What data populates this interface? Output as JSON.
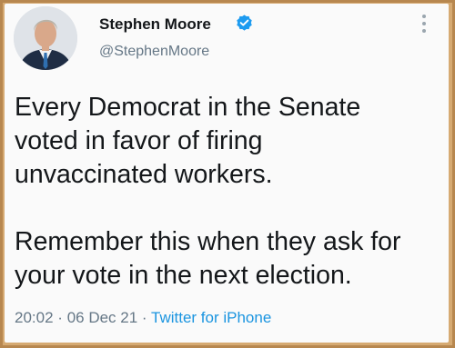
{
  "tweet": {
    "display_name": "Stephen Moore",
    "handle": "@StephenMoore",
    "verified_icon": "verified-badge-icon",
    "text": "Every Democrat in the Senate\nvoted in favor of firing\nunvaccinated workers.\n\nRemember this when they ask for\nyour vote in the next election.",
    "time": "20:02",
    "date": "06 Dec 21",
    "separator": "·",
    "source": "Twitter for iPhone"
  },
  "colors": {
    "frame": "#c8995f",
    "card_background": "#fafafa",
    "text_primary": "#14171a",
    "text_secondary": "#657786",
    "link": "#1b95e0",
    "verified": "#1d9bf0"
  }
}
